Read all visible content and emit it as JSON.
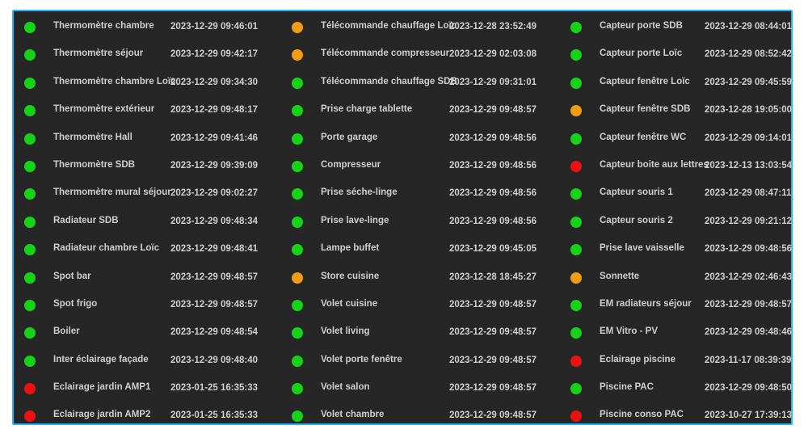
{
  "status_colors": {
    "ok": "#17d317",
    "warn": "#f39c12",
    "alert": "#ee1111"
  },
  "columns": [
    [
      {
        "name": "Thermomètre chambre",
        "time": "2023-12-29 09:46:01",
        "status": "green"
      },
      {
        "name": "Thermomètre séjour",
        "time": "2023-12-29 09:42:17",
        "status": "green"
      },
      {
        "name": "Thermomètre chambre Loïc",
        "time": "2023-12-29 09:34:30",
        "status": "green"
      },
      {
        "name": "Thermomètre extérieur",
        "time": "2023-12-29 09:48:17",
        "status": "green"
      },
      {
        "name": "Thermomètre Hall",
        "time": "2023-12-29 09:41:46",
        "status": "green"
      },
      {
        "name": "Thermomètre SDB",
        "time": "2023-12-29 09:39:09",
        "status": "green"
      },
      {
        "name": "Thermomètre mural séjour",
        "time": "2023-12-29 09:02:27",
        "status": "green"
      },
      {
        "name": "Radiateur SDB",
        "time": "2023-12-29 09:48:34",
        "status": "green"
      },
      {
        "name": "Radiateur chambre Loïc",
        "time": "2023-12-29 09:48:41",
        "status": "green"
      },
      {
        "name": "Spot bar",
        "time": "2023-12-29 09:48:57",
        "status": "green"
      },
      {
        "name": "Spot frigo",
        "time": "2023-12-29 09:48:57",
        "status": "green"
      },
      {
        "name": "Boiler",
        "time": "2023-12-29 09:48:54",
        "status": "green"
      },
      {
        "name": "Inter éclairage façade",
        "time": "2023-12-29 09:48:40",
        "status": "green"
      },
      {
        "name": "Eclairage jardin AMP1",
        "time": "2023-01-25 16:35:33",
        "status": "red"
      },
      {
        "name": "Eclairage jardin AMP2",
        "time": "2023-01-25 16:35:33",
        "status": "red"
      }
    ],
    [
      {
        "name": "Télécommande chauffage Loïc",
        "time": "2023-12-28 23:52:49",
        "status": "orange"
      },
      {
        "name": "Télécommande compresseur",
        "time": "2023-12-29 02:03:08",
        "status": "orange"
      },
      {
        "name": "Télécommande chauffage SDB",
        "time": "2023-12-29 09:31:01",
        "status": "green"
      },
      {
        "name": "Prise charge tablette",
        "time": "2023-12-29 09:48:57",
        "status": "green"
      },
      {
        "name": "Porte garage",
        "time": "2023-12-29 09:48:56",
        "status": "green"
      },
      {
        "name": "Compresseur",
        "time": "2023-12-29 09:48:56",
        "status": "green"
      },
      {
        "name": "Prise séche-linge",
        "time": "2023-12-29 09:48:56",
        "status": "green"
      },
      {
        "name": "Prise lave-linge",
        "time": "2023-12-29 09:48:56",
        "status": "green"
      },
      {
        "name": "Lampe buffet",
        "time": "2023-12-29 09:45:05",
        "status": "green"
      },
      {
        "name": "Store cuisine",
        "time": "2023-12-28 18:45:27",
        "status": "orange"
      },
      {
        "name": "Volet cuisine",
        "time": "2023-12-29 09:48:57",
        "status": "green"
      },
      {
        "name": "Volet living",
        "time": "2023-12-29 09:48:57",
        "status": "green"
      },
      {
        "name": "Volet porte fenêtre",
        "time": "2023-12-29 09:48:57",
        "status": "green"
      },
      {
        "name": "Volet salon",
        "time": "2023-12-29 09:48:57",
        "status": "green"
      },
      {
        "name": "Volet chambre",
        "time": "2023-12-29 09:48:57",
        "status": "green"
      }
    ],
    [
      {
        "name": "Capteur porte SDB",
        "time": "2023-12-29 08:44:01",
        "status": "green"
      },
      {
        "name": "Capteur porte Loïc",
        "time": "2023-12-29 08:52:42",
        "status": "green"
      },
      {
        "name": "Capteur fenêtre Loïc",
        "time": "2023-12-29 09:45:59",
        "status": "green"
      },
      {
        "name": "Capteur fenêtre SDB",
        "time": "2023-12-28 19:05:00",
        "status": "orange"
      },
      {
        "name": "Capteur fenêtre WC",
        "time": "2023-12-29 09:14:01",
        "status": "green"
      },
      {
        "name": "Capteur boite aux lettres",
        "time": "2023-12-13 13:03:54",
        "status": "red"
      },
      {
        "name": "Capteur souris 1",
        "time": "2023-12-29 08:47:11",
        "status": "green"
      },
      {
        "name": "Capteur souris 2",
        "time": "2023-12-29 09:21:12",
        "status": "green"
      },
      {
        "name": "Prise lave vaisselle",
        "time": "2023-12-29 09:48:56",
        "status": "green"
      },
      {
        "name": "Sonnette",
        "time": "2023-12-29 02:46:43",
        "status": "orange"
      },
      {
        "name": "EM radiateurs séjour",
        "time": "2023-12-29 09:48:57",
        "status": "green"
      },
      {
        "name": "EM Vitro - PV",
        "time": "2023-12-29 09:48:46",
        "status": "green"
      },
      {
        "name": "Eclairage piscine",
        "time": "2023-11-17 08:39:39",
        "status": "red"
      },
      {
        "name": "Piscine PAC",
        "time": "2023-12-29 09:48:50",
        "status": "green"
      },
      {
        "name": "Piscine conso PAC",
        "time": "2023-10-27 17:39:13",
        "status": "red"
      }
    ]
  ]
}
